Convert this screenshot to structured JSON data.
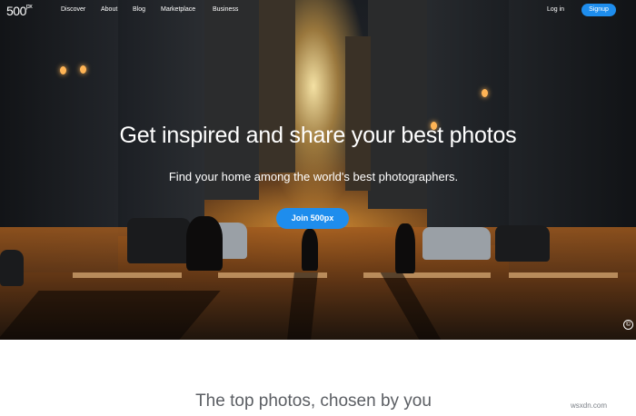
{
  "brand": {
    "logo_main": "500",
    "logo_sup": "px"
  },
  "nav": {
    "items": [
      {
        "label": "Discover"
      },
      {
        "label": "About"
      },
      {
        "label": "Blog"
      },
      {
        "label": "Marketplace"
      },
      {
        "label": "Business"
      }
    ],
    "login": "Log in",
    "signup": "Signup"
  },
  "hero": {
    "headline": "Get inspired and share your best photos",
    "subline": "Find your home among the world's best photographers.",
    "cta": "Join 500px",
    "copyright_symbol": "©"
  },
  "section": {
    "title": "The top photos, chosen by you"
  },
  "watermark": "wsxdn.com",
  "colors": {
    "accent": "#1e8ded",
    "section_title": "#5b5e63"
  }
}
